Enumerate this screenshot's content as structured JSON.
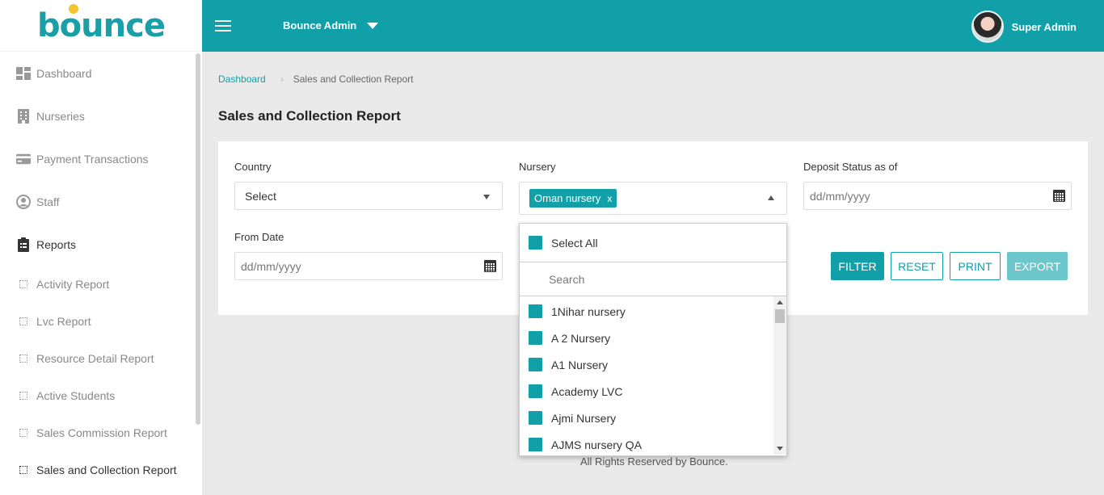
{
  "brand": {
    "logo_text": "bounce",
    "app_name": "Bounce Admin",
    "user_name": "Super Admin"
  },
  "sidebar": {
    "items": [
      {
        "label": "Dashboard",
        "icon": "dashboard-icon"
      },
      {
        "label": "Nurseries",
        "icon": "building-icon"
      },
      {
        "label": "Payment Transactions",
        "icon": "credit-card-icon"
      },
      {
        "label": "Staff",
        "icon": "user-circle-icon"
      },
      {
        "label": "Reports",
        "icon": "clipboard-icon"
      }
    ],
    "report_items": [
      {
        "label": "Activity Report"
      },
      {
        "label": "Lvc Report"
      },
      {
        "label": "Resource Detail Report"
      },
      {
        "label": "Active Students"
      },
      {
        "label": "Sales Commission Report"
      },
      {
        "label": "Sales and Collection Report"
      }
    ]
  },
  "breadcrumb": {
    "home": "Dashboard",
    "current": "Sales and Collection Report"
  },
  "page_title": "Sales and Collection Report",
  "form": {
    "country_label": "Country",
    "country_value": "Select",
    "nursery_label": "Nursery",
    "nursery_tag": "Oman nursery",
    "tag_remove": "x",
    "deposit_label": "Deposit Status as of",
    "deposit_placeholder": "dd/mm/yyyy",
    "from_label": "From Date",
    "from_placeholder": "dd/mm/yyyy"
  },
  "buttons": {
    "filter": "FILTER",
    "reset": "RESET",
    "print": "PRINT",
    "export": "EXPORT"
  },
  "dropdown": {
    "select_all": "Select All",
    "search_placeholder": "Search",
    "options": [
      {
        "label": "1Nihar nursery"
      },
      {
        "label": "A 2 Nursery"
      },
      {
        "label": "A1 Nursery"
      },
      {
        "label": "Academy LVC"
      },
      {
        "label": "Ajmi Nursery"
      },
      {
        "label": "AJMS nursery QA"
      }
    ]
  },
  "footer": "All Rights Reserved by Bounce.",
  "colors": {
    "primary": "#12a0a8",
    "export_disabled": "#6cc7cc",
    "logo_dot": "#f4c430"
  }
}
